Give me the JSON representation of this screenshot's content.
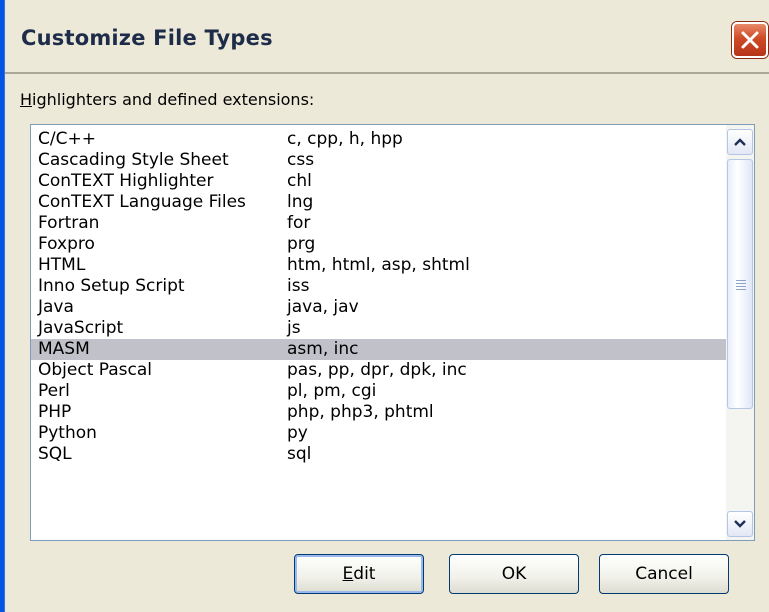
{
  "dialog": {
    "title": "Customize File Types",
    "group_label": {
      "accel": "H",
      "rest": "ighlighters and defined extensions:"
    }
  },
  "list": {
    "rows": [
      {
        "name": "C/C++",
        "ext": "c, cpp, h, hpp"
      },
      {
        "name": "Cascading Style Sheet",
        "ext": "css"
      },
      {
        "name": "ConTEXT Highlighter",
        "ext": "chl"
      },
      {
        "name": "ConTEXT Language Files",
        "ext": "lng"
      },
      {
        "name": "Fortran",
        "ext": "for"
      },
      {
        "name": "Foxpro",
        "ext": "prg"
      },
      {
        "name": "HTML",
        "ext": "htm, html, asp, shtml"
      },
      {
        "name": "Inno Setup Script",
        "ext": "iss"
      },
      {
        "name": "Java",
        "ext": "java, jav"
      },
      {
        "name": "JavaScript",
        "ext": "js"
      },
      {
        "name": "MASM",
        "ext": "asm, inc",
        "selected": true
      },
      {
        "name": "Object Pascal",
        "ext": "pas, pp, dpr, dpk, inc"
      },
      {
        "name": "Perl",
        "ext": "pl, pm, cgi"
      },
      {
        "name": "PHP",
        "ext": "php, php3, phtml"
      },
      {
        "name": "Python",
        "ext": "py"
      },
      {
        "name": "SQL",
        "ext": "sql"
      }
    ],
    "selected_index": 10
  },
  "buttons": {
    "edit": {
      "accel": "E",
      "rest": "dit"
    },
    "ok": "OK",
    "cancel": "Cancel"
  },
  "icons": {
    "close": "close-icon",
    "scroll_up": "chevron-up-icon",
    "scroll_down": "chevron-down-icon",
    "thumb_grip": "grip-icon"
  },
  "colors": {
    "dialog_bg": "#ece9d8",
    "selected_row": "#c1c1c9",
    "close_button": "#cf4a25",
    "frame_blue": "#0055e5"
  }
}
